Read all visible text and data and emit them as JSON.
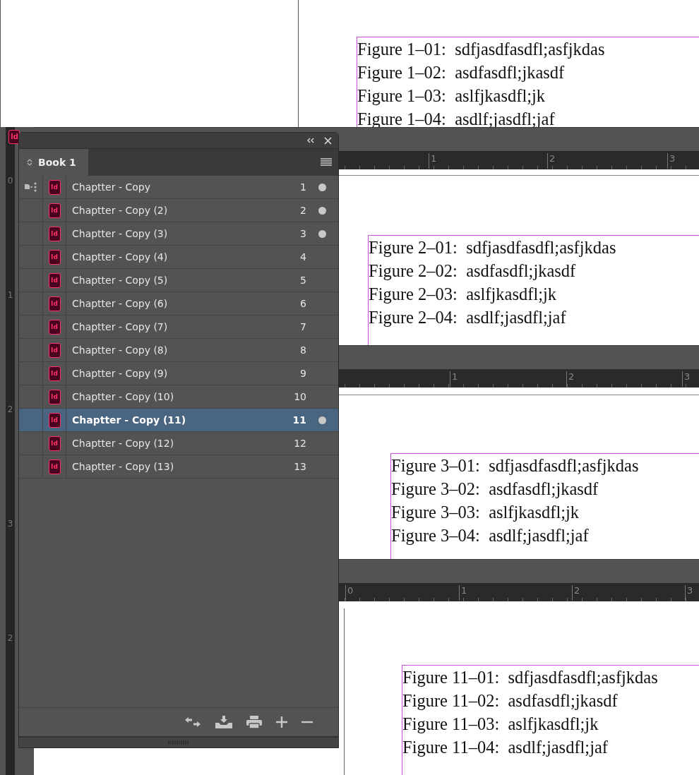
{
  "app_icon": {
    "text": "Id"
  },
  "background_page": {
    "figures": [
      "Figure 1–01:  sdfjasdfasdfl;asfjkdas",
      "Figure 1–02:  asdfasdfl;jkasdf",
      "Figure 1–03:  aslfjkasdfl;jk",
      "Figure 1–04:  asdlf;jasdfl;jaf"
    ]
  },
  "vertical_ruler": {
    "labels": [
      "0",
      "1",
      "2",
      "3",
      "2"
    ]
  },
  "documents": [
    {
      "ruler_labels": [
        "1",
        "2",
        "3"
      ],
      "figures": [
        "Figure 2–01:  sdfjasdfasdfl;asfjkdas",
        "Figure 2–02:  asdfasdfl;jkasdf",
        "Figure 2–03:  aslfjkasdfl;jk",
        "Figure 2–04:  asdlf;jasdfl;jaf"
      ]
    },
    {
      "ruler_labels": [
        "1",
        "2",
        "3"
      ],
      "figures": [
        "Figure 3–01:  sdfjasdfasdfl;asfjkdas",
        "Figure 3–02:  asdfasdfl;jkasdf",
        "Figure 3–03:  aslfjkasdfl;jk",
        "Figure 3–04:  asdlf;jasdfl;jaf"
      ]
    },
    {
      "ruler_labels": [
        "0",
        "1",
        "2",
        "3"
      ],
      "figures": [
        "Figure 11–01:  sdfjasdfasdfl;asfjkdas",
        "Figure 11–02:  asdfasdfl;jkasdf",
        "Figure 11–03:  aslfjkasdfl;jk",
        "Figure 11–04:  asdlf;jasdfl;jaf"
      ]
    }
  ],
  "panel": {
    "tab": "Book 1",
    "items": [
      {
        "name": "Chaptter - Copy",
        "page": "1",
        "icon_text": "Id",
        "style_source": true,
        "open": true,
        "selected": false
      },
      {
        "name": "Chaptter - Copy (2)",
        "page": "2",
        "icon_text": "Id",
        "style_source": false,
        "open": true,
        "selected": false
      },
      {
        "name": "Chaptter - Copy (3)",
        "page": "3",
        "icon_text": "Id",
        "style_source": false,
        "open": true,
        "selected": false
      },
      {
        "name": "Chaptter - Copy (4)",
        "page": "4",
        "icon_text": "Id",
        "style_source": false,
        "open": false,
        "selected": false
      },
      {
        "name": "Chaptter - Copy (5)",
        "page": "5",
        "icon_text": "Id",
        "style_source": false,
        "open": false,
        "selected": false
      },
      {
        "name": "Chaptter - Copy (6)",
        "page": "6",
        "icon_text": "Id",
        "style_source": false,
        "open": false,
        "selected": false
      },
      {
        "name": "Chaptter - Copy (7)",
        "page": "7",
        "icon_text": "Id",
        "style_source": false,
        "open": false,
        "selected": false
      },
      {
        "name": "Chaptter - Copy (8)",
        "page": "8",
        "icon_text": "Id",
        "style_source": false,
        "open": false,
        "selected": false
      },
      {
        "name": "Chaptter - Copy (9)",
        "page": "9",
        "icon_text": "Id",
        "style_source": false,
        "open": false,
        "selected": false
      },
      {
        "name": "Chaptter - Copy (10)",
        "page": "10",
        "icon_text": "Id",
        "style_source": false,
        "open": false,
        "selected": false
      },
      {
        "name": "Chaptter - Copy (11)",
        "page": "11",
        "icon_text": "Id",
        "style_source": false,
        "open": true,
        "selected": true
      },
      {
        "name": "Chaptter - Copy (12)",
        "page": "12",
        "icon_text": "Id",
        "style_source": false,
        "open": false,
        "selected": false
      },
      {
        "name": "Chaptter - Copy (13)",
        "page": "13",
        "icon_text": "Id",
        "style_source": false,
        "open": false,
        "selected": false
      }
    ]
  }
}
